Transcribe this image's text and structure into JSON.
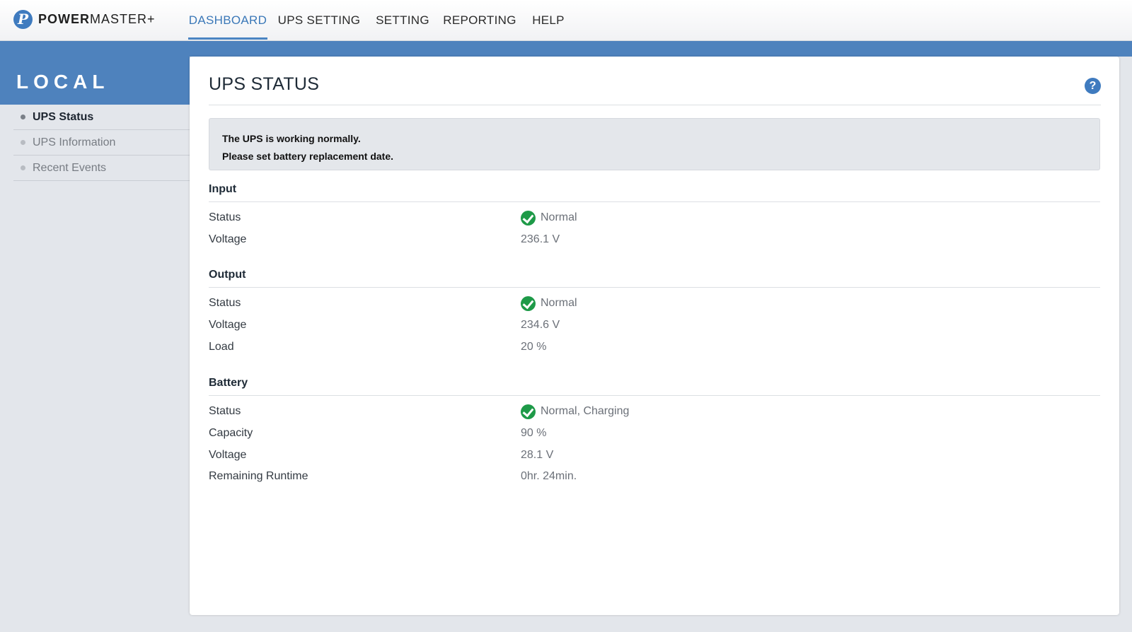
{
  "header": {
    "logo_mark": "P",
    "logo_bold": "POWER",
    "logo_rest": "MASTER+",
    "nav": [
      {
        "label": "DASHBOARD",
        "active": true
      },
      {
        "label": "UPS SETTING",
        "active": false
      },
      {
        "label": "SETTING",
        "active": false
      },
      {
        "label": "REPORTING",
        "active": false
      },
      {
        "label": "HELP",
        "active": false
      }
    ]
  },
  "sidebar": {
    "title": "LOCAL",
    "items": [
      {
        "label": "UPS Status",
        "active": true
      },
      {
        "label": "UPS Information",
        "active": false
      },
      {
        "label": "Recent Events",
        "active": false
      }
    ]
  },
  "main": {
    "title": "UPS STATUS",
    "help_icon": "?",
    "notice": {
      "line1": "The UPS is working normally.",
      "line2": "Please set battery replacement date."
    },
    "sections": [
      {
        "title": "Input",
        "rows": [
          {
            "label": "Status",
            "value": "Normal",
            "icon": "check-circle-icon"
          },
          {
            "label": "Voltage",
            "value": "236.1 V"
          }
        ]
      },
      {
        "title": "Output",
        "rows": [
          {
            "label": "Status",
            "value": "Normal",
            "icon": "check-circle-icon"
          },
          {
            "label": "Voltage",
            "value": "234.6 V"
          },
          {
            "label": "Load",
            "value": "20 %"
          }
        ]
      },
      {
        "title": "Battery",
        "rows": [
          {
            "label": "Status",
            "value": "Normal, Charging",
            "icon": "check-circle-icon"
          },
          {
            "label": "Capacity",
            "value": "90 %"
          },
          {
            "label": "Voltage",
            "value": "28.1 V"
          },
          {
            "label": "Remaining Runtime",
            "value": "0hr. 24min."
          }
        ]
      }
    ]
  },
  "colors": {
    "accent": "#3b78b8",
    "band": "#4e82bd",
    "ok": "#1e9a48"
  }
}
